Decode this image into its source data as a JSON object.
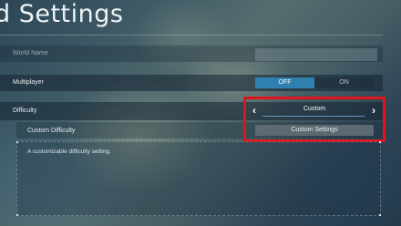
{
  "header": {
    "title": "d Settings"
  },
  "world_name": {
    "label": "World Name",
    "value": ""
  },
  "multiplayer": {
    "label": "Multiplayer",
    "off_label": "OFF",
    "on_label": "ON",
    "selected": "OFF"
  },
  "difficulty": {
    "label": "Difficulty",
    "value": "Custom"
  },
  "custom_difficulty": {
    "label": "Custom Difficulty",
    "button_label": "Custom Settings"
  },
  "description": {
    "text": "A customizable difficulty setting."
  },
  "colors": {
    "accent": "#2f7fb1",
    "highlight": "#e3131b"
  }
}
